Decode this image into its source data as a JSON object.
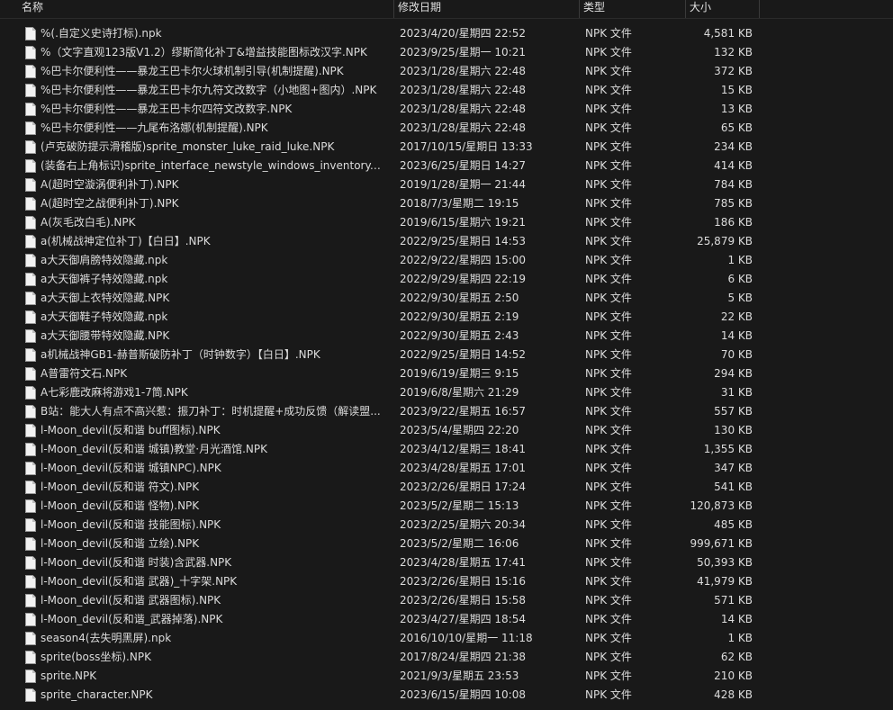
{
  "columns": {
    "name": "名称",
    "date": "修改日期",
    "type": "类型",
    "size": "大小"
  },
  "files": [
    {
      "name": "%(.自定义史诗打标).npk",
      "date": "2023/4/20/星期四 22:52",
      "type": "NPK 文件",
      "size": "4,581 KB"
    },
    {
      "name": "%（文字直观123版V1.2）缪斯简化补丁&增益技能图标改汉字.NPK",
      "date": "2023/9/25/星期一 10:21",
      "type": "NPK 文件",
      "size": "132 KB"
    },
    {
      "name": "%巴卡尔便利性——暴龙王巴卡尔火球机制引导(机制提醒).NPK",
      "date": "2023/1/28/星期六 22:48",
      "type": "NPK 文件",
      "size": "372 KB"
    },
    {
      "name": "%巴卡尔便利性——暴龙王巴卡尔九符文改数字（小地图+图内）.NPK",
      "date": "2023/1/28/星期六 22:48",
      "type": "NPK 文件",
      "size": "15 KB"
    },
    {
      "name": "%巴卡尔便利性——暴龙王巴卡尔四符文改数字.NPK",
      "date": "2023/1/28/星期六 22:48",
      "type": "NPK 文件",
      "size": "13 KB"
    },
    {
      "name": "%巴卡尔便利性——九尾布洛娜(机制提醒).NPK",
      "date": "2023/1/28/星期六 22:48",
      "type": "NPK 文件",
      "size": "65 KB"
    },
    {
      "name": "(卢克破防提示滑稽版)sprite_monster_luke_raid_luke.NPK",
      "date": "2017/10/15/星期日 13:33",
      "type": "NPK 文件",
      "size": "234 KB"
    },
    {
      "name": "(装备右上角标识)sprite_interface_newstyle_windows_inventory.NPK",
      "date": "2023/6/25/星期日 14:27",
      "type": "NPK 文件",
      "size": "414 KB"
    },
    {
      "name": "A(超时空漩涡便利补丁).NPK",
      "date": "2019/1/28/星期一 21:44",
      "type": "NPK 文件",
      "size": "784 KB"
    },
    {
      "name": "A(超时空之战便利补丁).NPK",
      "date": "2018/7/3/星期二 19:15",
      "type": "NPK 文件",
      "size": "785 KB"
    },
    {
      "name": "A(灰毛改白毛).NPK",
      "date": "2019/6/15/星期六 19:21",
      "type": "NPK 文件",
      "size": "186 KB"
    },
    {
      "name": "a(机械战神定位补丁)【白日】.NPK",
      "date": "2022/9/25/星期日 14:53",
      "type": "NPK 文件",
      "size": "25,879 KB"
    },
    {
      "name": "a大天御肩膀特效隐藏.npk",
      "date": "2022/9/22/星期四 15:00",
      "type": "NPK 文件",
      "size": "1 KB"
    },
    {
      "name": "a大天御裤子特效隐藏.npk",
      "date": "2022/9/29/星期四 22:19",
      "type": "NPK 文件",
      "size": "6 KB"
    },
    {
      "name": "a大天御上衣特效隐藏.NPK",
      "date": "2022/9/30/星期五 2:50",
      "type": "NPK 文件",
      "size": "5 KB"
    },
    {
      "name": "a大天御鞋子特效隐藏.npk",
      "date": "2022/9/30/星期五 2:19",
      "type": "NPK 文件",
      "size": "22 KB"
    },
    {
      "name": "a大天御腰带特效隐藏.NPK",
      "date": "2022/9/30/星期五 2:43",
      "type": "NPK 文件",
      "size": "14 KB"
    },
    {
      "name": "a机械战神GB1-赫普斯破防补丁（时钟数字）【白日】.NPK",
      "date": "2022/9/25/星期日 14:52",
      "type": "NPK 文件",
      "size": "70 KB"
    },
    {
      "name": "A普雷符文石.NPK",
      "date": "2019/6/19/星期三 9:15",
      "type": "NPK 文件",
      "size": "294 KB"
    },
    {
      "name": "A七彩鹿改麻将游戏1-7筒.NPK",
      "date": "2019/6/8/星期六 21:29",
      "type": "NPK 文件",
      "size": "31 KB"
    },
    {
      "name": "B站：能大人有点不高兴惹：振刀补丁：时机提醒+成功反馈（解读盟...",
      "date": "2023/9/22/星期五 16:57",
      "type": "NPK 文件",
      "size": "557 KB"
    },
    {
      "name": "l-Moon_devil(反和谐 buff图标).NPK",
      "date": "2023/5/4/星期四 22:20",
      "type": "NPK 文件",
      "size": "130 KB"
    },
    {
      "name": "l-Moon_devil(反和谐 城镇)教堂·月光酒馆.NPK",
      "date": "2023/4/12/星期三 18:41",
      "type": "NPK 文件",
      "size": "1,355 KB"
    },
    {
      "name": "l-Moon_devil(反和谐 城镇NPC).NPK",
      "date": "2023/4/28/星期五 17:01",
      "type": "NPK 文件",
      "size": "347 KB"
    },
    {
      "name": "l-Moon_devil(反和谐 符文).NPK",
      "date": "2023/2/26/星期日 17:24",
      "type": "NPK 文件",
      "size": "541 KB"
    },
    {
      "name": "l-Moon_devil(反和谐 怪物).NPK",
      "date": "2023/5/2/星期二 15:13",
      "type": "NPK 文件",
      "size": "120,873 KB"
    },
    {
      "name": "l-Moon_devil(反和谐 技能图标).NPK",
      "date": "2023/2/25/星期六 20:34",
      "type": "NPK 文件",
      "size": "485 KB"
    },
    {
      "name": "l-Moon_devil(反和谐 立绘).NPK",
      "date": "2023/5/2/星期二 16:06",
      "type": "NPK 文件",
      "size": "999,671 KB"
    },
    {
      "name": "l-Moon_devil(反和谐 时装)含武器.NPK",
      "date": "2023/4/28/星期五 17:41",
      "type": "NPK 文件",
      "size": "50,393 KB"
    },
    {
      "name": "l-Moon_devil(反和谐 武器)_十字架.NPK",
      "date": "2023/2/26/星期日 15:16",
      "type": "NPK 文件",
      "size": "41,979 KB"
    },
    {
      "name": "l-Moon_devil(反和谐 武器图标).NPK",
      "date": "2023/2/26/星期日 15:58",
      "type": "NPK 文件",
      "size": "571 KB"
    },
    {
      "name": "l-Moon_devil(反和谐_武器掉落).NPK",
      "date": "2023/4/27/星期四 18:54",
      "type": "NPK 文件",
      "size": "14 KB"
    },
    {
      "name": "season4(去失明黑屏).npk",
      "date": "2016/10/10/星期一 11:18",
      "type": "NPK 文件",
      "size": "1 KB"
    },
    {
      "name": "sprite(boss坐标).NPK",
      "date": "2017/8/24/星期四 21:38",
      "type": "NPK 文件",
      "size": "62 KB"
    },
    {
      "name": "sprite.NPK",
      "date": "2021/9/3/星期五 23:53",
      "type": "NPK 文件",
      "size": "210 KB"
    },
    {
      "name": "sprite_character.NPK",
      "date": "2023/6/15/星期四 10:08",
      "type": "NPK 文件",
      "size": "428 KB"
    }
  ]
}
